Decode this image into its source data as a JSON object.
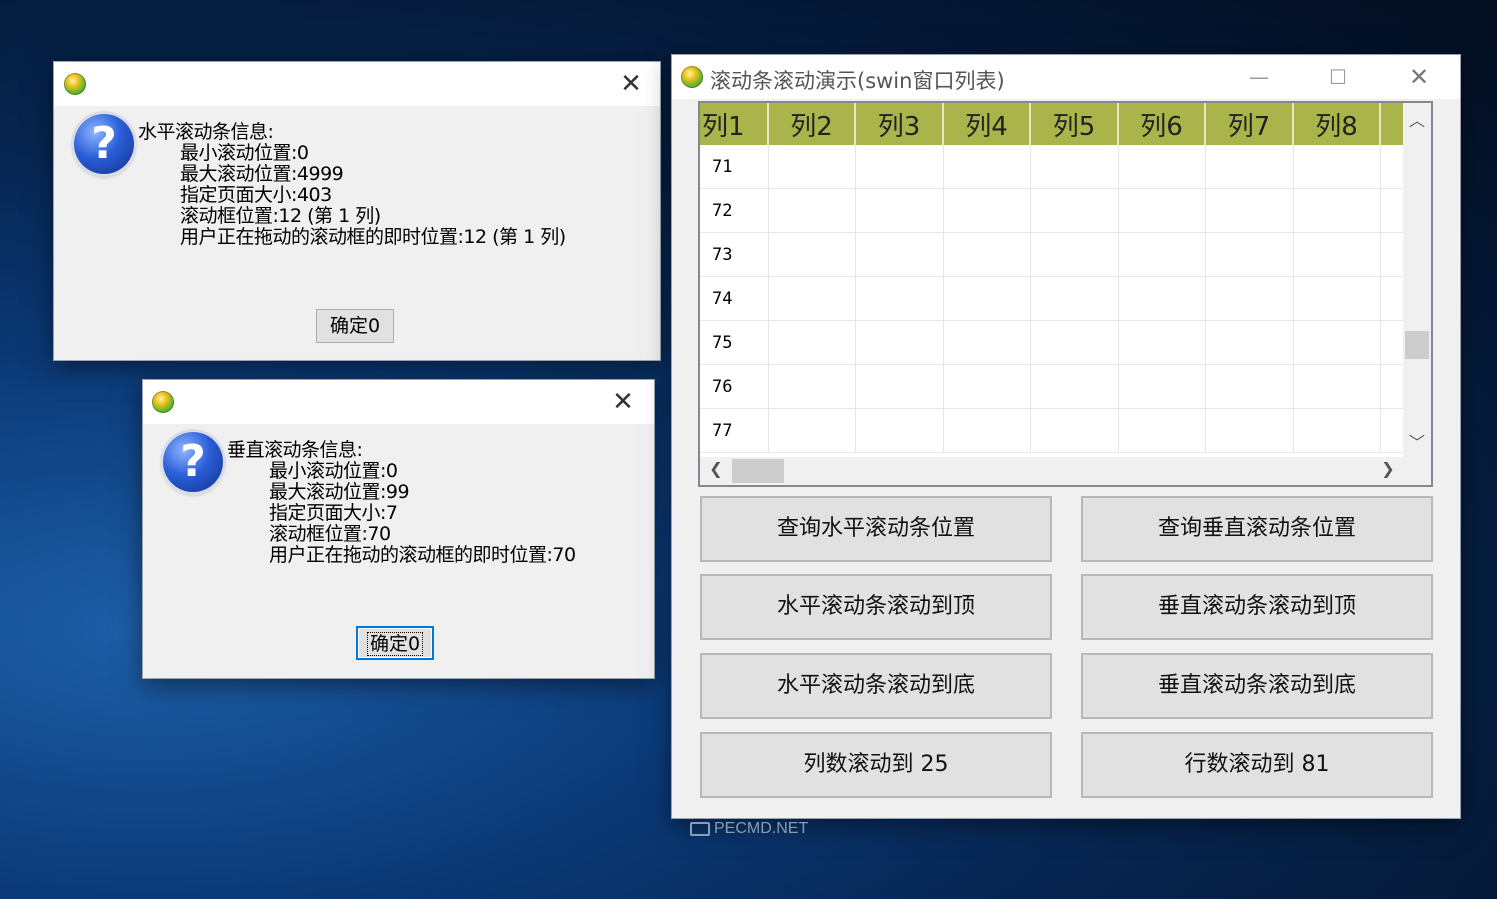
{
  "dialog_horizontal": {
    "title": "",
    "heading": "水平滚动条信息:",
    "lines": [
      "最小滚动位置:0",
      "最大滚动位置:4999",
      "指定页面大小:403",
      "滚动框位置:12 (第 1 列)",
      "用户正在拖动的滚动框的即时位置:12 (第 1 列)"
    ],
    "ok_label": "确定0"
  },
  "dialog_vertical": {
    "title": "",
    "heading": "垂直滚动条信息:",
    "lines": [
      "最小滚动位置:0",
      "最大滚动位置:99",
      "指定页面大小:7",
      "滚动框位置:70",
      "用户正在拖动的滚动框的即时位置:70"
    ],
    "ok_label": "确定0"
  },
  "main_window": {
    "title": "滚动条滚动演示(swin窗口列表)",
    "columns": [
      "列1",
      "列2",
      "列3",
      "列4",
      "列5",
      "列6",
      "列7",
      "列8"
    ],
    "rows": [
      "71",
      "72",
      "73",
      "74",
      "75",
      "76",
      "77"
    ],
    "buttons": {
      "query_h": "查询水平滚动条位置",
      "query_v": "查询垂直滚动条位置",
      "h_top": "水平滚动条滚动到顶",
      "v_top": "垂直滚动条滚动到顶",
      "h_bottom": "水平滚动条滚动到底",
      "v_bottom": "垂直滚动条滚动到底",
      "col_to": "列数滚动到 25",
      "row_to": "行数滚动到 81"
    }
  },
  "watermark": "PECMD.NET",
  "colors": {
    "header_bg": "#a9b44a",
    "focus_border": "#0078d7"
  },
  "icons": {
    "app": "app-globe-icon",
    "question": "question-icon",
    "close": "close-icon"
  }
}
